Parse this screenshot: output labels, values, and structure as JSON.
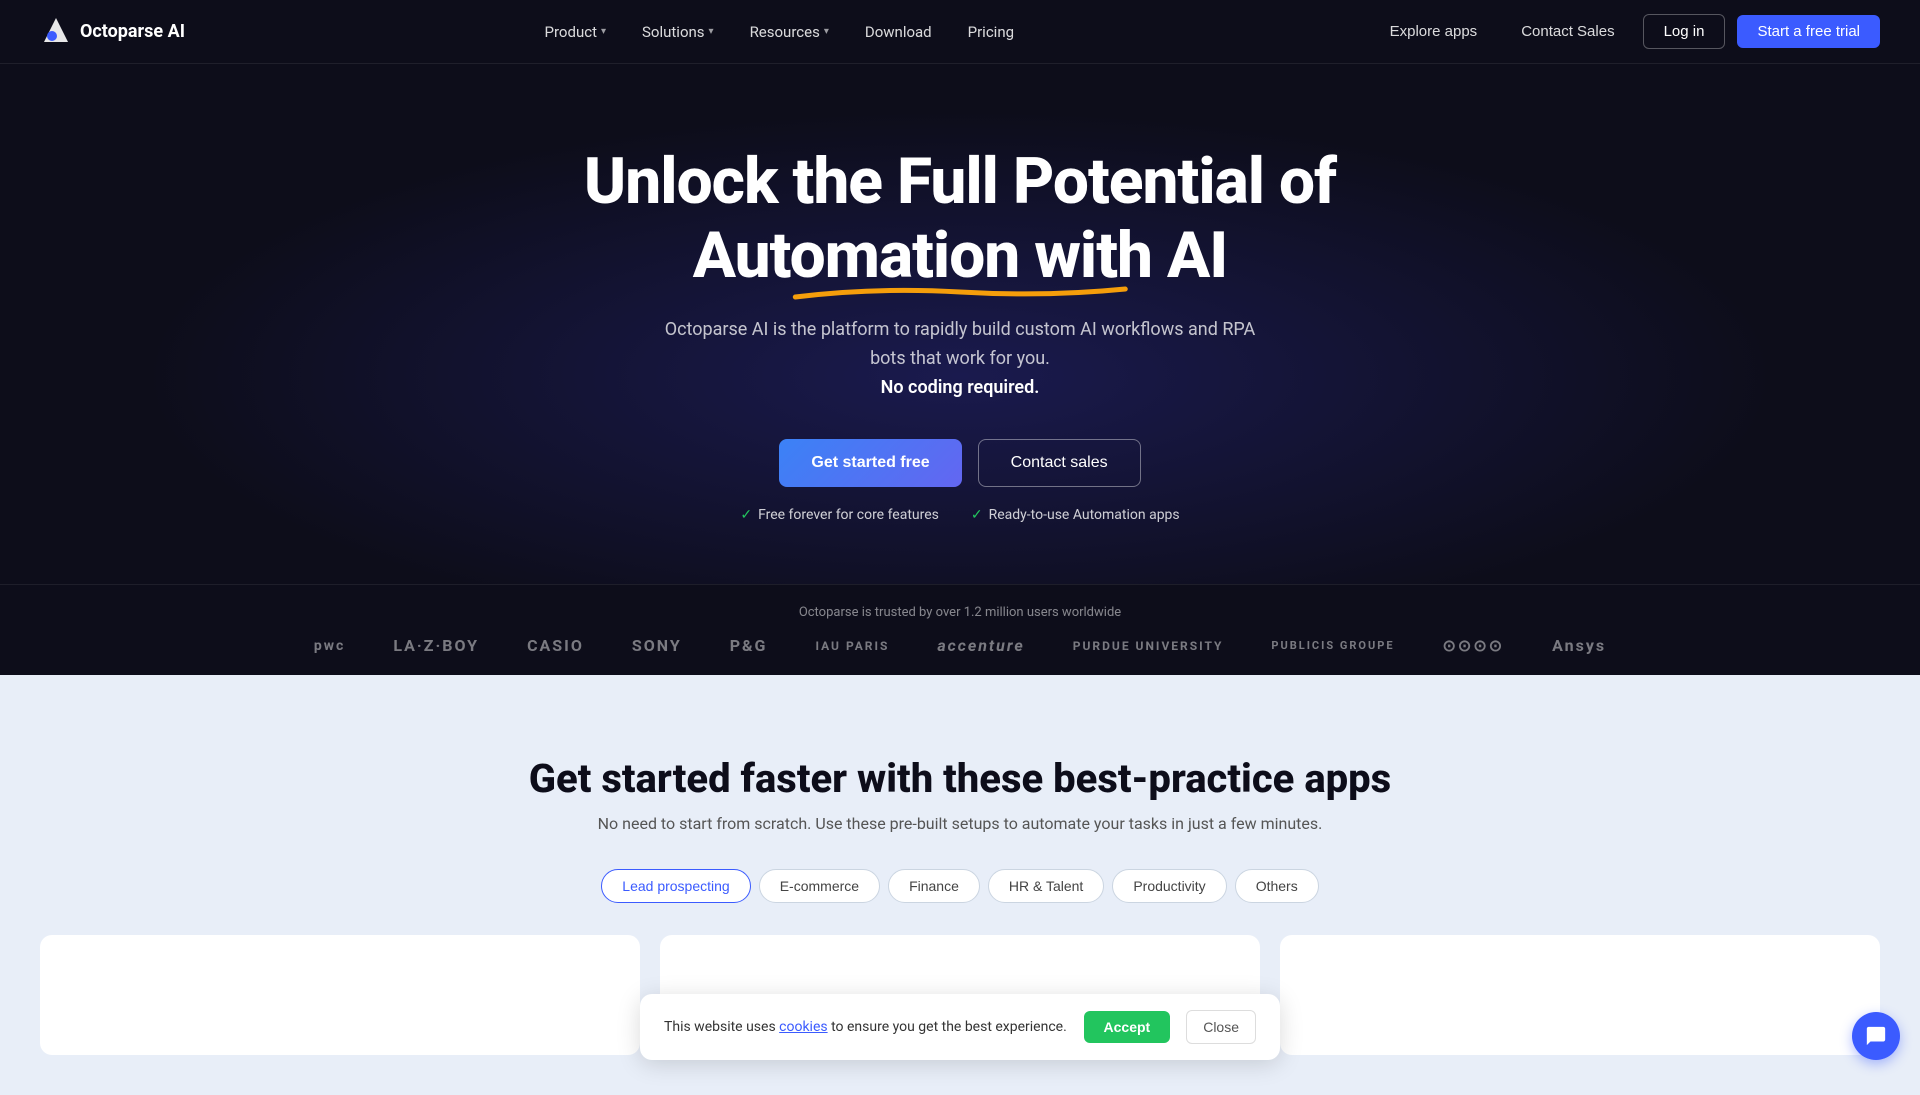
{
  "brand": {
    "name": "Octoparse AI",
    "logo_alt": "Octoparse AI logo"
  },
  "nav": {
    "items": [
      {
        "label": "Product",
        "has_dropdown": true
      },
      {
        "label": "Solutions",
        "has_dropdown": true
      },
      {
        "label": "Resources",
        "has_dropdown": true
      },
      {
        "label": "Download",
        "has_dropdown": false
      },
      {
        "label": "Pricing",
        "has_dropdown": false
      }
    ],
    "explore": "Explore apps",
    "contact_sales": "Contact Sales",
    "login": "Log in",
    "trial": "Start a free trial"
  },
  "hero": {
    "headline_part1": "Unlock the Full Potential of",
    "headline_part2": "Automation with AI",
    "underline_highlight": "with AI",
    "subtext": "Octoparse AI is the platform to rapidly build custom AI workflows and RPA bots that work for you.",
    "bold_sub": "No coding required.",
    "btn_start": "Get started free",
    "btn_contact": "Contact sales",
    "checks": [
      {
        "icon": "✓",
        "label": "Free forever for core features"
      },
      {
        "icon": "✓",
        "label": "Ready-to-use Automation apps"
      }
    ]
  },
  "logos": {
    "trust_text": "Octoparse is trusted by over 1.2 million users worldwide",
    "items": [
      {
        "name": "PwC",
        "style": "pwc"
      },
      {
        "name": "LA-Z-BOY",
        "style": ""
      },
      {
        "name": "CASIO",
        "style": ""
      },
      {
        "name": "SONY",
        "style": ""
      },
      {
        "name": "P&G",
        "style": ""
      },
      {
        "name": "IAU PARIS",
        "style": ""
      },
      {
        "name": "accenture",
        "style": ""
      },
      {
        "name": "PURDUE UNIVERSITY",
        "style": ""
      },
      {
        "name": "PUBLICIS GROUPE",
        "style": ""
      },
      {
        "name": "Audi",
        "style": ""
      },
      {
        "name": "Ansys",
        "style": ""
      }
    ]
  },
  "apps_section": {
    "title": "Get started faster with these best-practice apps",
    "subtitle": "No need to start from scratch. Use these pre-built setups to automate your tasks in just a few minutes.",
    "tabs": [
      {
        "label": "Lead prospecting",
        "active": true
      },
      {
        "label": "E-commerce",
        "active": false
      },
      {
        "label": "Finance",
        "active": false
      },
      {
        "label": "HR & Talent",
        "active": false
      },
      {
        "label": "Productivity",
        "active": false
      },
      {
        "label": "Others",
        "active": false
      }
    ]
  },
  "cookie": {
    "text": "This website uses",
    "link_text": "cookies",
    "text2": "to ensure you get the best experience.",
    "accept": "Accept",
    "close": "Close"
  },
  "colors": {
    "accent_blue": "#3b5bff",
    "accent_green": "#22c55e",
    "underline_color": "#f59e0b"
  }
}
